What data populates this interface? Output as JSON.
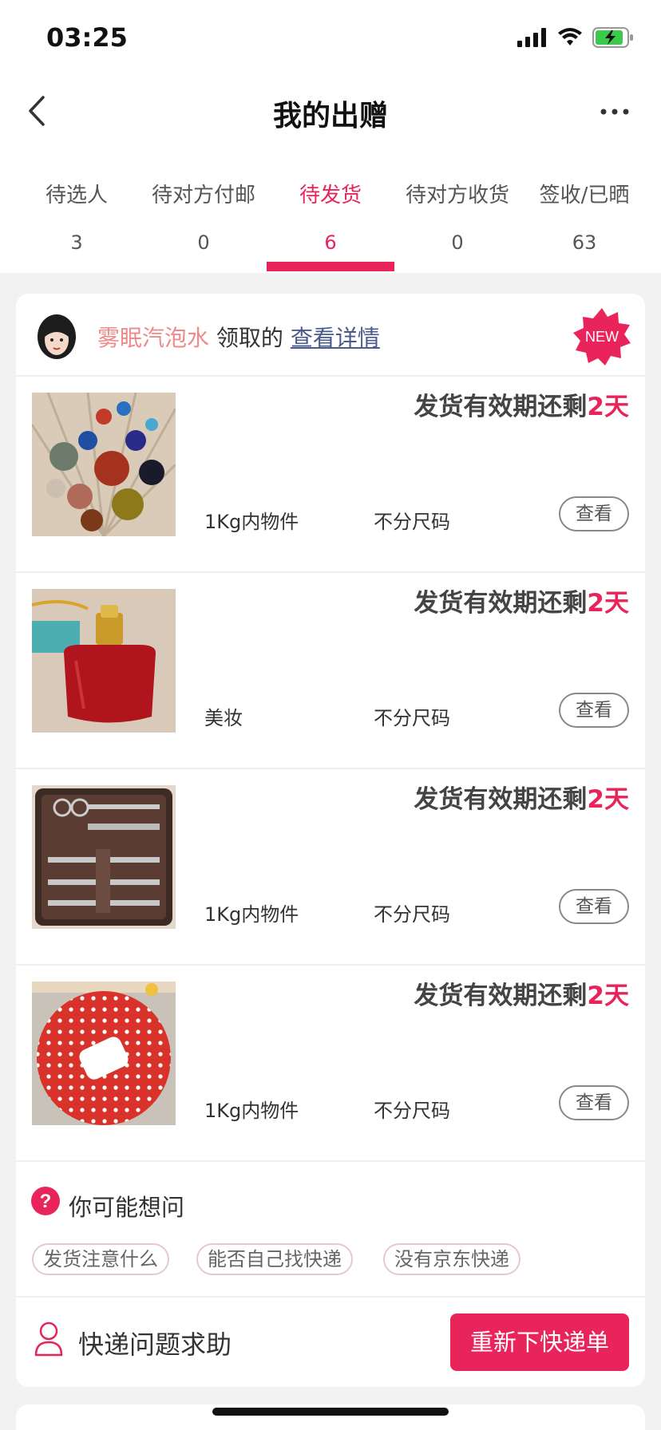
{
  "status": {
    "time": "03:25"
  },
  "nav": {
    "title": "我的出赠"
  },
  "tabs": [
    {
      "label": "待选人",
      "count": "3"
    },
    {
      "label": "待对方付邮",
      "count": "0"
    },
    {
      "label": "待发货",
      "count": "6",
      "active": true
    },
    {
      "label": "待对方收货",
      "count": "0"
    },
    {
      "label": "签收/已晒",
      "count": "63"
    }
  ],
  "card": {
    "receiver_name": "雾眠汽泡水",
    "received_text": " 领取的 ",
    "detail_link": "查看详情",
    "badge": "NEW",
    "items": [
      {
        "deadline_prefix": "发货有效期还剩",
        "deadline_value": "2天",
        "category": "1Kg内物件",
        "size": "不分尺码",
        "view_label": "查看",
        "image": "beads-photo"
      },
      {
        "deadline_prefix": "发货有效期还剩",
        "deadline_value": "2天",
        "category": "美妆",
        "size": "不分尺码",
        "view_label": "查看",
        "image": "perfume-photo"
      },
      {
        "deadline_prefix": "发货有效期还剩",
        "deadline_value": "2天",
        "category": "1Kg内物件",
        "size": "不分尺码",
        "view_label": "查看",
        "image": "manicure-set-photo"
      },
      {
        "deadline_prefix": "发货有效期还剩",
        "deadline_value": "2天",
        "category": "1Kg内物件",
        "size": "不分尺码",
        "view_label": "查看",
        "image": "party-plate-photo"
      }
    ],
    "faq": {
      "title": "你可能想问",
      "chips": [
        "发货注意什么",
        "能否自己找快递",
        "没有京东快递"
      ]
    },
    "help": {
      "label": "快递问题求助",
      "button": "重新下快递单"
    }
  },
  "colors": {
    "accent": "#e8245b",
    "nickname": "#ef8a8a",
    "link": "#4a5a8c"
  }
}
